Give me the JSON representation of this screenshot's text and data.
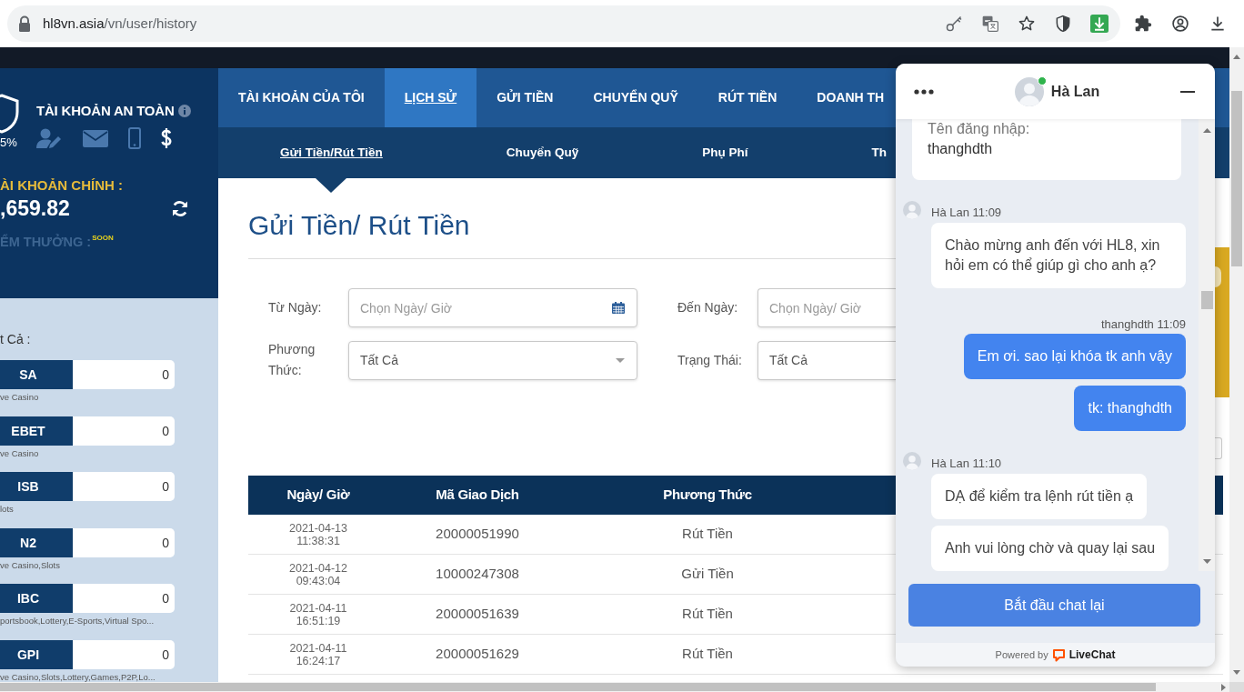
{
  "browser": {
    "url": {
      "domain": "hl8vn.asia",
      "path": "/vn/user/history"
    }
  },
  "sidebar": {
    "security": {
      "percent": "5%",
      "title": "TÀI KHOẢN AN TOÀN",
      "icons": [
        {
          "kind": "profile",
          "verified": false
        },
        {
          "kind": "email",
          "verified": false
        },
        {
          "kind": "phone",
          "verified": false
        },
        {
          "kind": "money",
          "verified": true
        }
      ]
    },
    "balance": {
      "label": "ÀI KHOẢN CHÍNH :",
      "amount": ",659.82"
    },
    "points": {
      "label": "ỂM THƯỞNG :",
      "badge": "SOON"
    },
    "wallets_label": "t Cả :",
    "wallets": [
      {
        "name": "SA",
        "balance": "0",
        "games": "ve Casino"
      },
      {
        "name": "EBET",
        "balance": "0",
        "games": "ve Casino"
      },
      {
        "name": "ISB",
        "balance": "0",
        "games": "lots"
      },
      {
        "name": "N2",
        "balance": "0",
        "games": "ve Casino,Slots"
      },
      {
        "name": "IBC",
        "balance": "0",
        "games": "portsbook,Lottery,E-Sports,Virtual Spo..."
      },
      {
        "name": "GPI",
        "balance": "0",
        "games": "ve Casino,Slots,Lottery,Games,P2P,Lo..."
      }
    ]
  },
  "nav": {
    "tabs": [
      {
        "label": "TÀI KHOẢN CỦA TÔI",
        "selected": false
      },
      {
        "label": "LỊCH SỬ",
        "selected": true
      },
      {
        "label": "GỬI TIỀN",
        "selected": false
      },
      {
        "label": "CHUYỂN QUỸ",
        "selected": false
      },
      {
        "label": "RÚT TIỀN",
        "selected": false
      },
      {
        "label": "DOANH TH",
        "selected": false
      }
    ]
  },
  "subnav": {
    "tabs": [
      {
        "label": "Gửi Tiền/Rút Tiền",
        "selected": true
      },
      {
        "label": "Chuyển Quỹ",
        "selected": false
      },
      {
        "label": "Phụ Phí",
        "selected": false
      },
      {
        "label": "Th",
        "selected": false
      }
    ]
  },
  "content": {
    "title": "Gửi Tiền/ Rút Tiền",
    "filters": [
      {
        "kind": "date",
        "label": "Từ Ngày:",
        "placeholder": "Chọn Ngày/ Giờ",
        "clipped": false
      },
      {
        "kind": "date",
        "label": "Đến Ngày:",
        "placeholder": "Chọn Ngày/ Giờ",
        "clipped": true
      },
      {
        "kind": "select",
        "label": "Phương Thức:",
        "value": "Tất Cả",
        "clipped": false
      },
      {
        "kind": "select",
        "label": "Trạng Thái:",
        "value": "Tất Cả",
        "clipped": true
      }
    ],
    "table": {
      "columns": [
        "Ngày/ Giờ",
        "Mã Giao Dịch",
        "Phương Thức"
      ],
      "rows": [
        {
          "date": "2021-04-13",
          "time": "11:38:31",
          "id": "20000051990",
          "method": "Rút Tiền"
        },
        {
          "date": "2021-04-12",
          "time": "09:43:04",
          "id": "10000247308",
          "method": "Gửi Tiền"
        },
        {
          "date": "2021-04-11",
          "time": "16:51:19",
          "id": "20000051639",
          "method": "Rút Tiền"
        },
        {
          "date": "2021-04-11",
          "time": "16:24:17",
          "id": "20000051629",
          "method": "Rút Tiền"
        }
      ]
    }
  },
  "chat": {
    "agent": {
      "name": "Hà Lan",
      "online": true
    },
    "messages": [
      {
        "kind": "form",
        "label": "Tên đăng nhập:",
        "value": "thanghdth"
      },
      {
        "kind": "agent",
        "header": "Hà Lan 11:09",
        "bubbles": [
          "Chào mừng anh đến với HL8, xin hỏi em có thể giúp gì cho anh ạ?"
        ]
      },
      {
        "kind": "visitor",
        "header": "thanghdth 11:09",
        "bubbles": [
          "Em ơi. sao lại khóa tk anh vậy",
          "tk: thanghdth"
        ]
      },
      {
        "kind": "agent",
        "header": "Hà Lan 11:10",
        "bubbles": [
          "DẠ để kiểm tra lệnh rút tiền ạ",
          "Anh vui lòng chờ và quay lại sau"
        ]
      }
    ],
    "button": "Bắt đầu chat lại",
    "powered_by": "Powered by",
    "brand": "LiveChat"
  }
}
